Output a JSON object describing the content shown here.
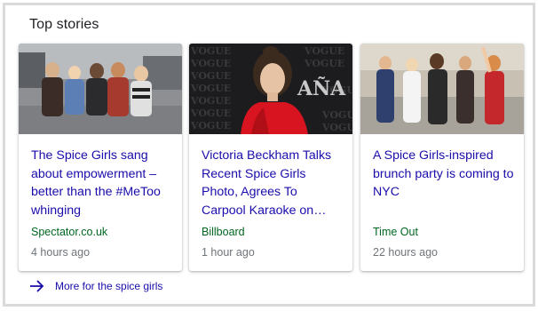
{
  "top_stories": {
    "title": "Top stories",
    "cards": [
      {
        "headline": "The Spice Girls sang about empowerment – better than the #MeToo whinging",
        "source": "Spectator.co.uk",
        "time": "4 hours ago",
        "image": "spice-girls-street-photo"
      },
      {
        "headline": "Victoria Beckham Talks Recent Spice Girls Photo, Agrees To Carpool Karaoke on…",
        "source": "Billboard",
        "time": "1 hour ago",
        "image": "victoria-beckham-vogue-photo"
      },
      {
        "headline": "A Spice Girls-inspired brunch party is coming to NYC",
        "source": "Time Out",
        "time": "22 hours ago",
        "image": "spice-girls-group-photo"
      }
    ],
    "more_link": "More for the spice girls"
  },
  "colors": {
    "link": "#1a0dab",
    "source": "#006621",
    "muted": "#70757a",
    "border": "#dadada"
  },
  "icons": {
    "more": "arrow-right-icon"
  }
}
